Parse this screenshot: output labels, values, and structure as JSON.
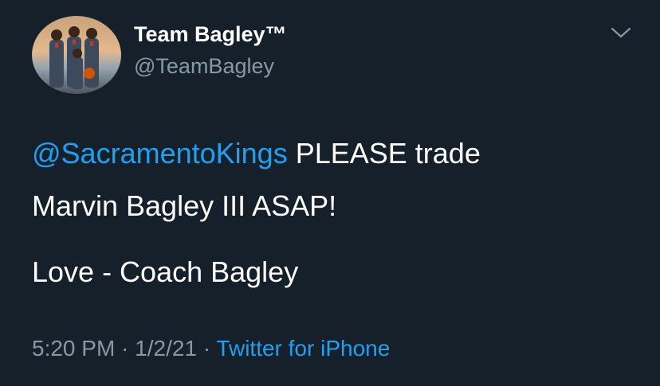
{
  "author": {
    "display_name": "Team Bagley™",
    "handle": "@TeamBagley"
  },
  "tweet": {
    "mention": "@SacramentoKings",
    "line1_rest": " PLEASE trade",
    "line2": "Marvin Bagley III ASAP!",
    "line3": "Love - Coach Bagley"
  },
  "meta": {
    "time": "5:20 PM",
    "separator1": " · ",
    "date": "1/2/21",
    "separator2": " · ",
    "source": "Twitter for iPhone"
  },
  "icons": {
    "menu": "chevron-down-icon",
    "avatar": "profile-photo"
  },
  "colors": {
    "background": "#15202b",
    "text": "#ffffff",
    "secondary": "#8899a6",
    "link": "#1da1f2"
  }
}
